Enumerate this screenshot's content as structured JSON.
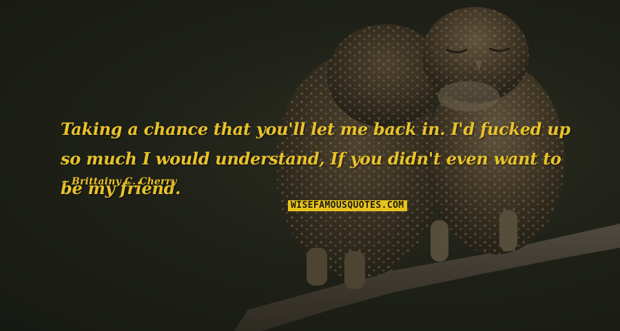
{
  "quote": {
    "text": "Taking a chance that you'll let me back in. I'd fucked up so much I would understand, If you didn't even want to be my friend."
  },
  "author": {
    "name": "Brittainy C. Cherry"
  },
  "watermark": {
    "label": "WISEFAMOUSQUOTES.COM"
  },
  "colors": {
    "text": "#e8c22a",
    "badge_bg": "#e7c21d",
    "background": "#1c1f18"
  }
}
